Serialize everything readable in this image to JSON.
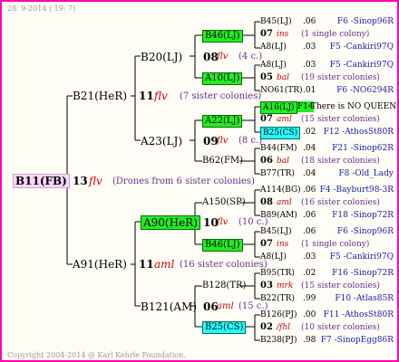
{
  "header_date": "28.  9-2014 ( 19:  7)",
  "footer": "Copyright 2004-2014 @ Karl Kehrle Foundation.",
  "root": {
    "id": "B11(FB)",
    "gen": "13",
    "flv": "flv",
    "note": "(Drones from 6 sister colonies)"
  },
  "upper": {
    "id": "B21(HeR)",
    "gen": "11",
    "flv": "flv",
    "note": "(7 sister colonies)",
    "a": {
      "id": "B20(LJ)",
      "gen": "08",
      "flv": "flv",
      "note": "(4 c.)",
      "top": {
        "id": "B46(LJ)"
      },
      "bottom": {
        "id": "A10(LJ)"
      }
    },
    "b": {
      "id": "A23(LJ)",
      "gen": "09",
      "flv": "flv",
      "note": "(8 c.)",
      "top": {
        "id": "A22(LJ)"
      },
      "bottom": {
        "id": "B62(FM)"
      }
    }
  },
  "lower": {
    "id": "A91(HeR)",
    "gen": "11",
    "flv": "aml",
    "note": "(16 sister colonies)",
    "a": {
      "id": "A90(HeR)",
      "gen": "10",
      "flv": "flv",
      "note": "(10 c.)",
      "top": {
        "id": "A150(SP)"
      },
      "bottom": {
        "id": "B46(LJ)"
      }
    },
    "b": {
      "id": "B121(AM)",
      "gen": "06",
      "flv": "aml",
      "note": "(15 c.)",
      "top": {
        "id": "B128(TR)"
      },
      "bottom": {
        "id": "B25(CS)"
      }
    }
  },
  "leaves": [
    {
      "id": "B45(LJ)",
      "year": ".06",
      "right": "F6 -Sinop96R"
    },
    {
      "id": "07",
      "flv": "ins",
      "note": "(1 single colony)"
    },
    {
      "id": "A8(LJ)",
      "year": ".03",
      "right": "F5 -Cankiri97Q"
    },
    {
      "id": "A8(LJ)",
      "year": ".03",
      "right": "F5 -Cankiri97Q"
    },
    {
      "id": "05",
      "flv": "bal",
      "note": "(19 sister colonies)"
    },
    {
      "id": "NO61(TR)",
      "year": ".01",
      "right": "F6 -NO6294R"
    },
    {
      "id": "A16(LJ)",
      "year": "F14",
      "right": "There is NO QUEEN"
    },
    {
      "id": "07",
      "flv": "aml",
      "note": "(15 sister colonies)"
    },
    {
      "id": "B25(CS)",
      "year": ".02",
      "right": "F12 -AthosSt80R"
    },
    {
      "id": "B44(FM)",
      "year": ".04",
      "right": "F21 -Sinop62R"
    },
    {
      "id": "06",
      "flv": "bal",
      "note": "(18 sister colonies)"
    },
    {
      "id": "B77(TR)",
      "year": ".04",
      "right": "F8 -Old_Lady"
    },
    {
      "id": "A114(BG)",
      "year": ".06",
      "right": "F4 -Bayburt98-3R"
    },
    {
      "id": "08",
      "flv": "aml",
      "note": "(16 sister colonies)"
    },
    {
      "id": "B89(AM)",
      "year": ".06",
      "right": "F18 -Sinop72R"
    },
    {
      "id": "B45(LJ)",
      "year": ".06",
      "right": "F6 -Sinop96R"
    },
    {
      "id": "07",
      "flv": "ins",
      "note": "(1 single colony)"
    },
    {
      "id": "A8(LJ)",
      "year": ".03",
      "right": "F5 -Cankiri97Q"
    },
    {
      "id": "B95(TR)",
      "year": ".02",
      "right": "F16 -Sinop72R"
    },
    {
      "id": "03",
      "flv": "mrk",
      "note": "(15 sister colonies)"
    },
    {
      "id": "B22(TR)",
      "year": ".99",
      "right": "F10 -Atlas85R"
    },
    {
      "id": "B126(PJ)",
      "year": ".00",
      "right": "F11 -AthosSt80R"
    },
    {
      "id": "02",
      "flv": "/fhl",
      "note": "(10 sister colonies)"
    },
    {
      "id": "B238(PJ)",
      "year": ".98",
      "right": "F7 -SinopEgg86R"
    }
  ]
}
